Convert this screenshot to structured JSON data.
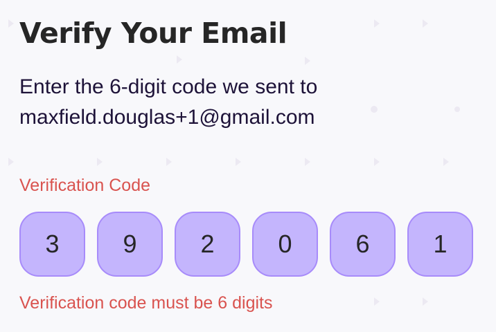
{
  "header": {
    "title": "Verify Your Email"
  },
  "instructions": {
    "line1": "Enter the 6-digit code we sent to",
    "line2": "maxfield.douglas+1@gmail.com"
  },
  "form": {
    "code_label": "Verification Code",
    "code_digits": [
      "3",
      "9",
      "2",
      "0",
      "6",
      "1"
    ],
    "error_message": "Verification code must be 6 digits"
  },
  "colors": {
    "background": "#f8f8fb",
    "title": "#262626",
    "body_text": "#1d1238",
    "error": "#d9534f",
    "code_box_fill": "#c4b5fd",
    "code_box_border": "#a78bfa",
    "pattern": "#ece9f2"
  }
}
